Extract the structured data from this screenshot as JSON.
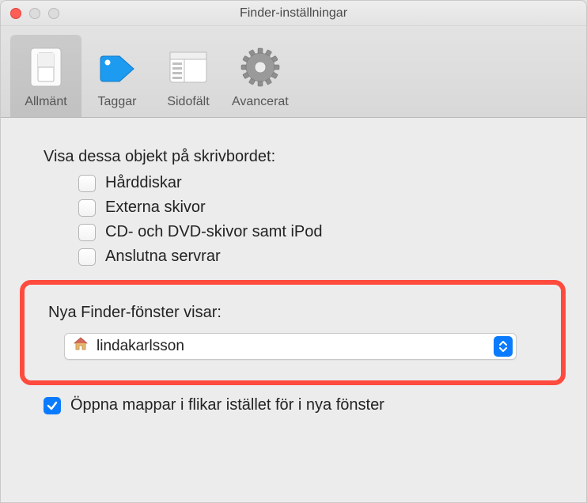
{
  "window": {
    "title": "Finder-inställningar"
  },
  "tabs": [
    {
      "label": "Allmänt"
    },
    {
      "label": "Taggar"
    },
    {
      "label": "Sidofält"
    },
    {
      "label": "Avancerat"
    }
  ],
  "desktop_section": {
    "label": "Visa dessa objekt på skrivbordet:",
    "items": [
      {
        "label": "Hårddiskar"
      },
      {
        "label": "Externa skivor"
      },
      {
        "label": "CD- och DVD-skivor samt iPod"
      },
      {
        "label": "Anslutna servrar"
      }
    ]
  },
  "new_window_section": {
    "label": "Nya Finder-fönster visar:",
    "dropdown_value": "lindakarlsson"
  },
  "tabs_checkbox": {
    "label": "Öppna mappar i flikar istället för i nya fönster"
  }
}
